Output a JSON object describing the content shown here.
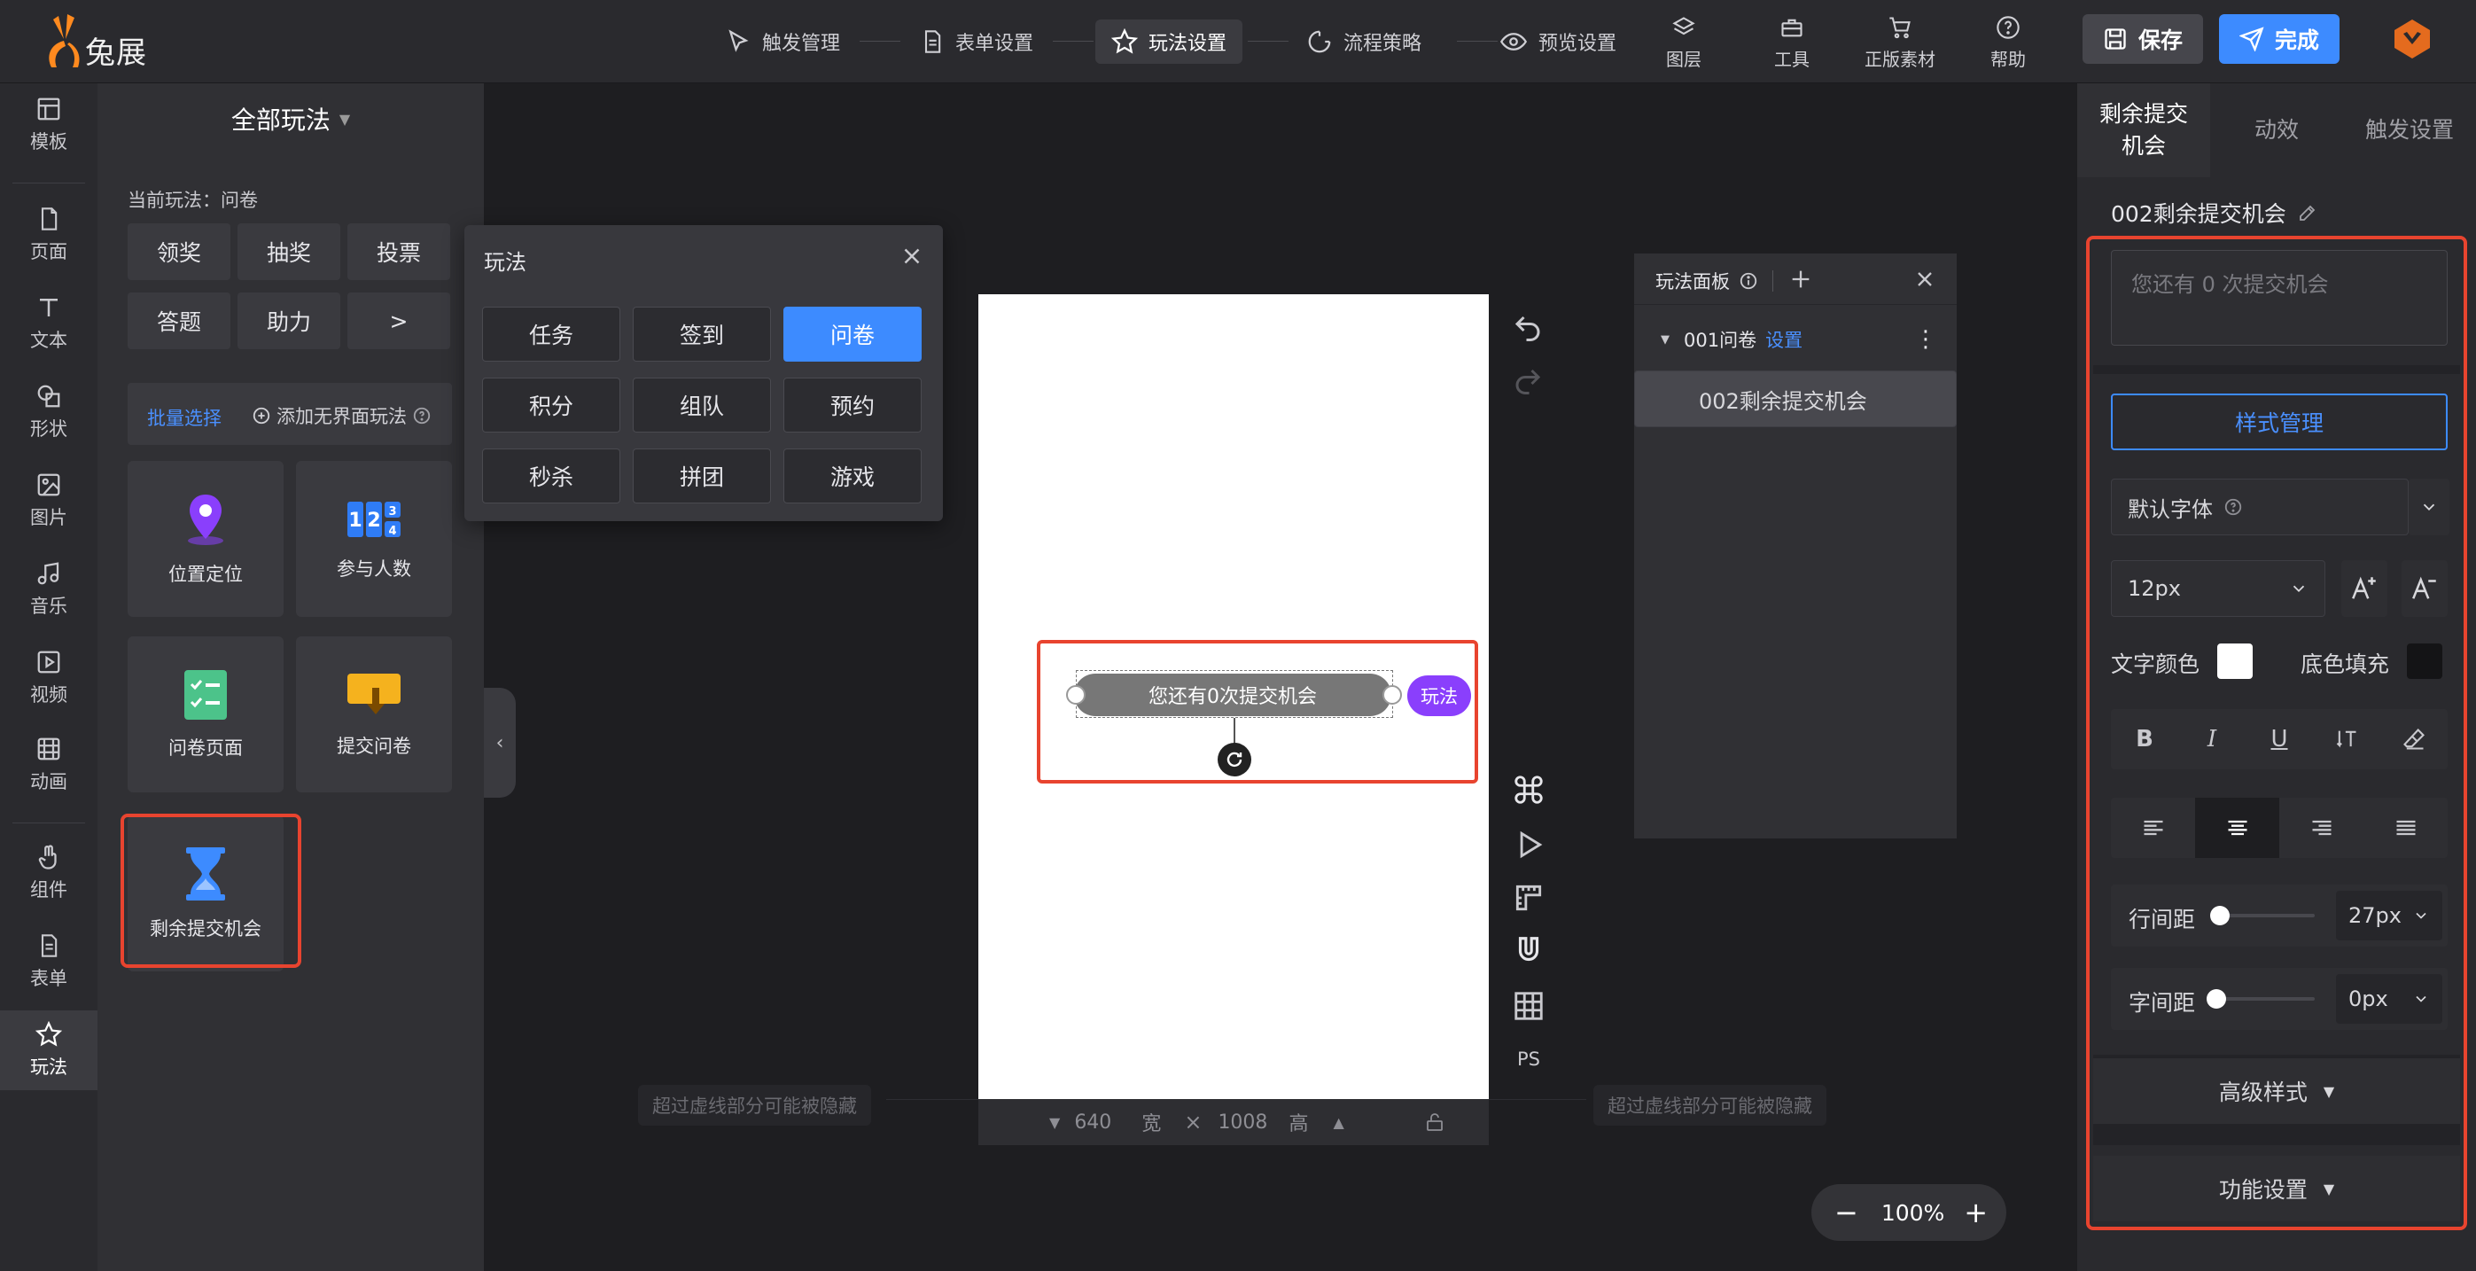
{
  "app": {
    "logo_text": "兔展"
  },
  "steps": [
    {
      "label": "触发管理"
    },
    {
      "label": "表单设置"
    },
    {
      "label": "玩法设置"
    },
    {
      "label": "流程策略"
    },
    {
      "label": "预览设置"
    }
  ],
  "tools": [
    {
      "label": "图层"
    },
    {
      "label": "工具"
    },
    {
      "label": "正版素材"
    },
    {
      "label": "帮助"
    }
  ],
  "header": {
    "save_label": "保存",
    "done_label": "完成"
  },
  "rail": [
    {
      "label": "模板"
    },
    {
      "label": "页面"
    },
    {
      "label": "文本"
    },
    {
      "label": "形状"
    },
    {
      "label": "图片"
    },
    {
      "label": "音乐"
    },
    {
      "label": "视频"
    },
    {
      "label": "动画"
    },
    {
      "label": "组件"
    },
    {
      "label": "表单"
    },
    {
      "label": "玩法"
    }
  ],
  "panel": {
    "title": "全部玩法",
    "current": "当前玩法：问卷",
    "tags": [
      "领奖",
      "抽奖",
      "投票",
      "答题",
      "助力",
      ">"
    ],
    "batch": "批量选择",
    "add": "添加无界面玩法",
    "cards": [
      {
        "label": "位置定位"
      },
      {
        "label": "参与人数"
      },
      {
        "label": "问卷页面"
      },
      {
        "label": "提交问卷"
      },
      {
        "label": "剩余提交机会"
      }
    ]
  },
  "popup": {
    "title": "玩法",
    "buttons": [
      "任务",
      "签到",
      "问卷",
      "积分",
      "组队",
      "预约",
      "秒杀",
      "拼团",
      "游戏"
    ],
    "active": "问卷"
  },
  "canvas": {
    "widget_text": "您还有0次提交机会",
    "play_tag": "玩法",
    "width": "640",
    "width_unit": "宽",
    "height": "1008",
    "height_unit": "高",
    "hint": "超过虚线部分可能被隐藏",
    "ps": "PS",
    "zoom": "100%"
  },
  "layers": {
    "title": "玩法面板",
    "group": "001问卷",
    "group_action": "设置",
    "item": "002剩余提交机会"
  },
  "right": {
    "tabs": [
      "剩余提交机会",
      "动效",
      "触发设置"
    ],
    "name": "002剩余提交机会",
    "placeholder": "您还有 0 次提交机会",
    "style_btn": "样式管理",
    "font": "默认字体",
    "size": "12px",
    "text_color_label": "文字颜色",
    "fill_label": "底色填充",
    "line_height_label": "行间距",
    "line_height": "27px",
    "letter_spacing_label": "字间距",
    "letter_spacing": "0px",
    "advanced": "高级样式",
    "function": "功能设置"
  },
  "colors": {
    "accent": "#3d8bff",
    "highlight": "#e8442f",
    "play": "#8a3ffc"
  }
}
